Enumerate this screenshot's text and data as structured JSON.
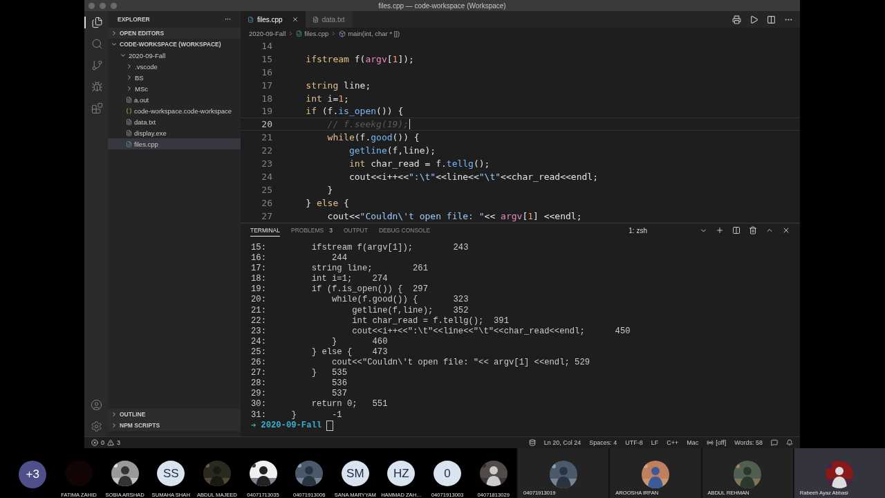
{
  "window": {
    "title": "files.cpp — code-workspace (Workspace)"
  },
  "activity_bar": [
    {
      "kind": "files",
      "selected": true
    },
    {
      "kind": "search",
      "selected": false
    },
    {
      "kind": "source",
      "selected": false
    },
    {
      "kind": "run",
      "selected": false
    },
    {
      "kind": "extensions",
      "selected": false
    }
  ],
  "sidebar": {
    "title": "EXPLORER",
    "more": "···",
    "sections": [
      {
        "label": "OPEN EDITORS",
        "expanded": false
      },
      {
        "label": "CODE-WORKSPACE (WORKSPACE)",
        "expanded": true
      }
    ],
    "tree": [
      {
        "label": "2020-09-Fall",
        "kind": "folder",
        "expanded": true,
        "selected": false,
        "children": [
          {
            "label": ".vscode",
            "kind": "folder",
            "expanded": false,
            "selected": false
          },
          {
            "label": "BS",
            "kind": "folder",
            "expanded": false,
            "selected": false
          },
          {
            "label": "MSc",
            "kind": "folder",
            "expanded": false,
            "selected": false
          },
          {
            "label": "a.out",
            "kind": "text",
            "selected": false
          },
          {
            "label": "code-workspace.code-workspace",
            "kind": "json",
            "selected": false
          },
          {
            "label": "data.txt",
            "kind": "text",
            "selected": false
          },
          {
            "label": "display.exe",
            "kind": "text",
            "selected": false
          },
          {
            "label": "files.cpp",
            "kind": "cpp",
            "selected": true
          }
        ]
      }
    ],
    "bottom_sections": [
      {
        "label": "OUTLINE",
        "expanded": false
      },
      {
        "label": "NPM SCRIPTS",
        "expanded": false
      }
    ]
  },
  "tabs": [
    {
      "label": "files.cpp",
      "kind": "cpp",
      "selected": true
    },
    {
      "label": "data.txt",
      "kind": "text",
      "selected": false
    }
  ],
  "breadcrumb": [
    {
      "label": "2020-09-Fall",
      "kind": "folder"
    },
    {
      "label": "files.cpp",
      "kind": "cpp"
    },
    {
      "label": "main(int, char * [])",
      "kind": "symbol"
    }
  ],
  "editor": {
    "lines": [
      {
        "number": "14",
        "current": false
      },
      {
        "number": "15",
        "current": false,
        "tokens": [
          {
            "kind": "type",
            "text": "    ifstream"
          },
          {
            "kind": "plain",
            "text": " f("
          },
          {
            "kind": "var",
            "text": "argv"
          },
          {
            "kind": "plain",
            "text": "["
          },
          {
            "kind": "num",
            "text": "1"
          },
          {
            "kind": "plain",
            "text": "]);"
          }
        ]
      },
      {
        "number": "16",
        "current": false
      },
      {
        "number": "17",
        "current": false,
        "tokens": [
          {
            "kind": "type",
            "text": "    string"
          },
          {
            "kind": "plain",
            "text": " line;"
          }
        ]
      },
      {
        "number": "18",
        "current": false,
        "tokens": [
          {
            "kind": "type",
            "text": "    int"
          },
          {
            "kind": "plain",
            "text": " i="
          },
          {
            "kind": "num",
            "text": "1"
          },
          {
            "kind": "plain",
            "text": ";"
          }
        ]
      },
      {
        "number": "19",
        "current": false,
        "tokens": [
          {
            "kind": "kw",
            "text": "    if"
          },
          {
            "kind": "plain",
            "text": " (f."
          },
          {
            "kind": "fn",
            "text": "is_open"
          },
          {
            "kind": "plain",
            "text": "()) {"
          }
        ]
      },
      {
        "number": "20",
        "current": true,
        "tokens": [
          {
            "kind": "comment",
            "text": "        // f.seekg(19);"
          }
        ]
      },
      {
        "number": "21",
        "current": false,
        "tokens": [
          {
            "kind": "kw",
            "text": "        while"
          },
          {
            "kind": "plain",
            "text": "(f."
          },
          {
            "kind": "fn",
            "text": "good"
          },
          {
            "kind": "plain",
            "text": "()) {"
          }
        ]
      },
      {
        "number": "22",
        "current": false,
        "tokens": [
          {
            "kind": "fn",
            "text": "            getline"
          },
          {
            "kind": "plain",
            "text": "(f,line);"
          }
        ]
      },
      {
        "number": "23",
        "current": false,
        "tokens": [
          {
            "kind": "type",
            "text": "            int"
          },
          {
            "kind": "plain",
            "text": " char_read = f."
          },
          {
            "kind": "fn",
            "text": "tellg"
          },
          {
            "kind": "plain",
            "text": "();"
          }
        ]
      },
      {
        "number": "24",
        "current": false,
        "tokens": [
          {
            "kind": "plain",
            "text": "            cout<<i++<<"
          },
          {
            "kind": "str",
            "text": "\":\\t\""
          },
          {
            "kind": "plain",
            "text": "<<line<<"
          },
          {
            "kind": "str",
            "text": "\"\\t\""
          },
          {
            "kind": "plain",
            "text": "<<char_read<<endl;"
          }
        ]
      },
      {
        "number": "25",
        "current": false,
        "tokens": [
          {
            "kind": "plain",
            "text": "        }"
          }
        ]
      },
      {
        "number": "26",
        "current": false,
        "tokens": [
          {
            "kind": "plain",
            "text": "    } "
          },
          {
            "kind": "kw",
            "text": "else"
          },
          {
            "kind": "plain",
            "text": " {"
          }
        ]
      },
      {
        "number": "27",
        "current": false,
        "tokens": [
          {
            "kind": "plain",
            "text": "        cout<<"
          },
          {
            "kind": "str",
            "text": "\"Couldn\\'t open file: \""
          },
          {
            "kind": "plain",
            "text": "<< "
          },
          {
            "kind": "var",
            "text": "argv"
          },
          {
            "kind": "plain",
            "text": "["
          },
          {
            "kind": "num",
            "text": "1"
          },
          {
            "kind": "plain",
            "text": "] <<endl;"
          }
        ]
      }
    ]
  },
  "panel": {
    "tabs": [
      {
        "label": "TERMINAL",
        "selected": true
      },
      {
        "label": "PROBLEMS",
        "badge": "3",
        "selected": false
      },
      {
        "label": "OUTPUT",
        "selected": false
      },
      {
        "label": "DEBUG CONSOLE",
        "selected": false
      }
    ],
    "terminal_select": "1: zsh",
    "output": [
      "15:         ifstream f(argv[1]);        243",
      "16:             244",
      "17:         string line;        261",
      "18:         int i=1;    274",
      "19:         if (f.is_open()) {  297",
      "20:             while(f.good()) {       323",
      "21:                 getline(f,line);    352",
      "22:                 int char_read = f.tellg();  391",
      "23:                 cout<<i++<<\":\\t\"<<line<<\"\\t\"<<char_read<<endl;      450",
      "24:             }       460",
      "25:         } else {    473",
      "26:             cout<<\"Couldn\\'t open file: \"<< argv[1] <<endl; 529",
      "27:         }   535",
      "28:             536",
      "29:             537",
      "30:         return 0;   551",
      "31:     }       -1"
    ],
    "prompt": {
      "arrow": "➜",
      "directory": "2020-09-Fall"
    }
  },
  "status_bar": {
    "errors": "0",
    "warnings": "3",
    "items": [
      "Ln 20, Col 24",
      "Spaces: 4",
      "UTF-8",
      "LF",
      "C++",
      "Mac"
    ],
    "live_share": "[off]",
    "words": "Words: 58"
  },
  "call": {
    "overflow": "+3",
    "participants": [
      {
        "name": "FATIMA ZAHID",
        "kind": "dark"
      },
      {
        "name": "SOBIA ARSHAD",
        "kind": "picture"
      },
      {
        "name": "SUMAHA SHAH",
        "kind": "initials",
        "initials": "SS"
      },
      {
        "name": "ABDUL MAJEED",
        "kind": "picture"
      },
      {
        "name": "04071713035",
        "kind": "picture"
      },
      {
        "name": "04071913006",
        "kind": "picture"
      },
      {
        "name": "SANA MARYYAM",
        "kind": "initials",
        "initials": "SM"
      },
      {
        "name": "HAMMAD ZAH…",
        "kind": "initials",
        "initials": "HZ"
      },
      {
        "name": "04071913003",
        "kind": "initials",
        "initials": "0"
      },
      {
        "name": "04071813029",
        "kind": "picture"
      }
    ],
    "tiles": [
      {
        "name": "04071913019",
        "selected": false
      },
      {
        "name": "AROOSHA IRFAN",
        "selected": false
      },
      {
        "name": "ABDUL REHMAN",
        "selected": false
      },
      {
        "name": "Rabeeh Ayaz  Abbasi",
        "selected": true
      }
    ]
  }
}
